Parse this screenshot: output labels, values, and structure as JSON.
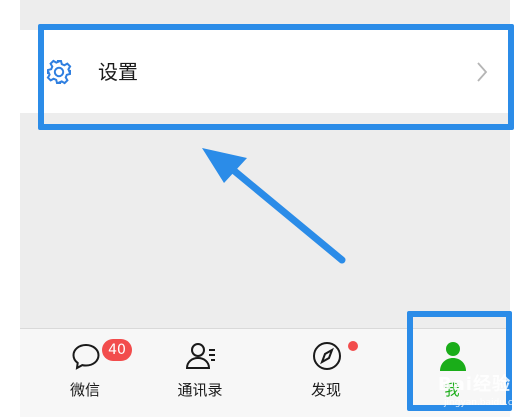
{
  "settings": {
    "label": "设置"
  },
  "tabs": [
    {
      "label": "微信",
      "badge": "40",
      "icon": "chat-bubble-icon"
    },
    {
      "label": "通讯录",
      "icon": "contacts-icon"
    },
    {
      "label": "发现",
      "icon": "compass-icon",
      "dot": true
    },
    {
      "label": "我",
      "icon": "person-icon",
      "active": true
    }
  ],
  "colors": {
    "accent_green": "#1aad19",
    "badge_red": "#f24c4c",
    "annotation_blue": "#2b8ce8",
    "settings_icon_blue": "#2f7fe0"
  },
  "watermark": {
    "text": "Bai经验",
    "sub": "jingyan.baidu.com"
  }
}
